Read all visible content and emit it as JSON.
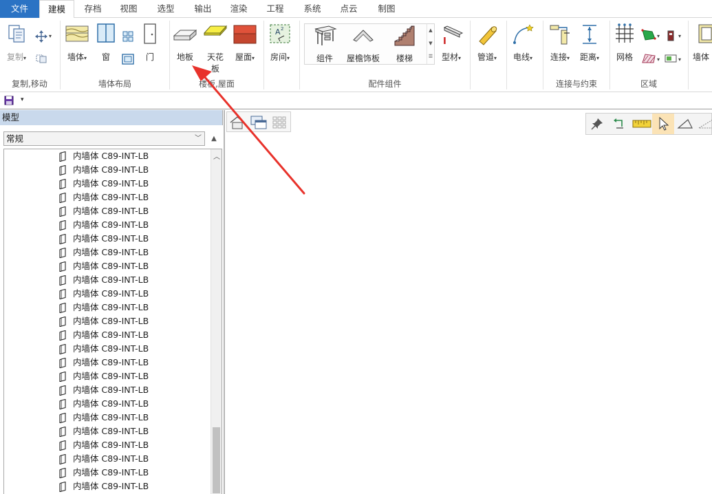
{
  "tabs": [
    {
      "label": "文件"
    },
    {
      "label": "建模"
    },
    {
      "label": "存档"
    },
    {
      "label": "视图"
    },
    {
      "label": "选型"
    },
    {
      "label": "输出"
    },
    {
      "label": "渲染"
    },
    {
      "label": "工程"
    },
    {
      "label": "系统"
    },
    {
      "label": "点云"
    },
    {
      "label": "制图"
    }
  ],
  "ribbon": {
    "groups": {
      "copy_move": "复制,移动",
      "wall_layout": "墙体布局",
      "floor_roof": "楼板,屋面",
      "components": "配件组件",
      "connect": "连接与约束",
      "region": "区域"
    },
    "buttons": {
      "copy": "复制",
      "wall": "墙体",
      "window": "窗",
      "door": "门",
      "floor": "地板",
      "ceiling_line1": "天花",
      "ceiling_line2": "板",
      "roof": "屋面",
      "room": "房间",
      "component": "组件",
      "eave": "屋檐饰板",
      "stair": "楼梯",
      "profile": "型材",
      "pipe": "管道",
      "wire": "电线",
      "connect": "连接",
      "distance": "距离",
      "grid": "网格",
      "wall_partial": "墙体"
    },
    "dropdown_marker": "▾"
  },
  "panel": {
    "title": "模型",
    "filter_value": "常规",
    "item_label": "内墙体 C89-INT-LB",
    "item_count": 25
  },
  "colors": {
    "file_tab": "#2b73c4",
    "panel_header": "#c9d9ec",
    "annotation_arrow": "#e8322b",
    "snap_selected": "#fbe3b6"
  }
}
